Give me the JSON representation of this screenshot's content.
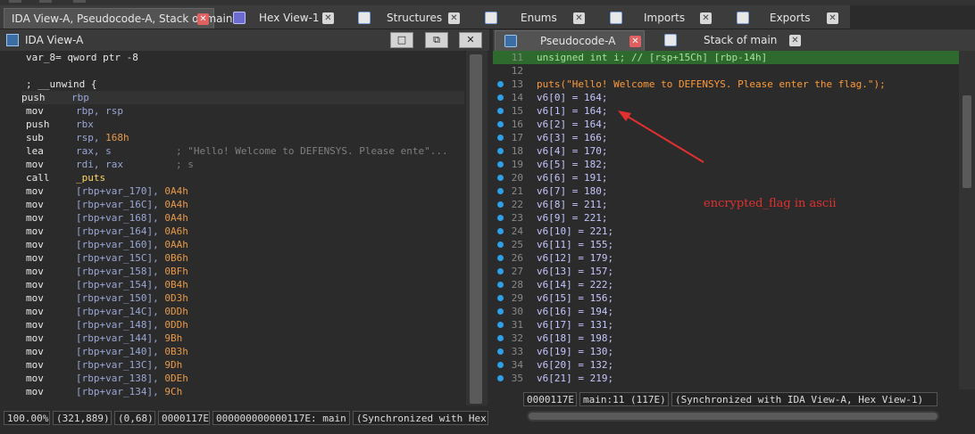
{
  "colors": {
    "accent_red": "#e23030",
    "sync_green": "#2e6a2e",
    "dot_blue": "#2ea0e8"
  },
  "tabs": [
    {
      "label": "IDA View-A, Pseudocode-A, Stack of main",
      "icon": "window-icon"
    },
    {
      "label": "Hex View-1",
      "icon": "hex-view-icon"
    },
    {
      "label": "Structures",
      "icon": "structures-icon"
    },
    {
      "label": "Enums",
      "icon": "enums-icon"
    },
    {
      "label": "Imports",
      "icon": "imports-icon"
    },
    {
      "label": "Exports",
      "icon": "exports-icon"
    }
  ],
  "left_panel": {
    "title": "IDA View-A",
    "buttons": {
      "restore": "□",
      "float": "⧉",
      "close": "✕"
    },
    "lines": [
      {
        "mn": "var_8= qword ptr -8",
        "op": "",
        "cm": ""
      },
      {
        "mn": "",
        "op": "",
        "cm": ""
      },
      {
        "mn": "; __unwind {",
        "op": "",
        "cm": ""
      },
      {
        "mn": "push",
        "op": "rbp",
        "cm": ""
      },
      {
        "mn": "mov",
        "op": "rbp, rsp",
        "cm": ""
      },
      {
        "mn": "push",
        "op": "rbx",
        "cm": ""
      },
      {
        "mn": "sub",
        "op": "rsp, ",
        "num": "168h",
        "cm": ""
      },
      {
        "mn": "lea",
        "op": "rax, s",
        "cm": "; \"Hello! Welcome to DEFENSYS. Please ente\"..."
      },
      {
        "mn": "mov",
        "op": "rdi, rax",
        "cm": "; s"
      },
      {
        "mn": "call",
        "op": "_puts",
        "cm": ""
      },
      {
        "mn": "mov",
        "op": "[rbp+var_170], ",
        "num": "0A4h",
        "cm": ""
      },
      {
        "mn": "mov",
        "op": "[rbp+var_16C], ",
        "num": "0A4h",
        "cm": ""
      },
      {
        "mn": "mov",
        "op": "[rbp+var_168], ",
        "num": "0A4h",
        "cm": ""
      },
      {
        "mn": "mov",
        "op": "[rbp+var_164], ",
        "num": "0A6h",
        "cm": ""
      },
      {
        "mn": "mov",
        "op": "[rbp+var_160], ",
        "num": "0AAh",
        "cm": ""
      },
      {
        "mn": "mov",
        "op": "[rbp+var_15C], ",
        "num": "0B6h",
        "cm": ""
      },
      {
        "mn": "mov",
        "op": "[rbp+var_158], ",
        "num": "0BFh",
        "cm": ""
      },
      {
        "mn": "mov",
        "op": "[rbp+var_154], ",
        "num": "0B4h",
        "cm": ""
      },
      {
        "mn": "mov",
        "op": "[rbp+var_150], ",
        "num": "0D3h",
        "cm": ""
      },
      {
        "mn": "mov",
        "op": "[rbp+var_14C], ",
        "num": "0DDh",
        "cm": ""
      },
      {
        "mn": "mov",
        "op": "[rbp+var_148], ",
        "num": "0DDh",
        "cm": ""
      },
      {
        "mn": "mov",
        "op": "[rbp+var_144], ",
        "num": "9Bh",
        "cm": ""
      },
      {
        "mn": "mov",
        "op": "[rbp+var_140], ",
        "num": "0B3h",
        "cm": ""
      },
      {
        "mn": "mov",
        "op": "[rbp+var_13C], ",
        "num": "9Dh",
        "cm": ""
      },
      {
        "mn": "mov",
        "op": "[rbp+var_138], ",
        "num": "0DEh",
        "cm": ""
      },
      {
        "mn": "mov",
        "op": "[rbp+var_134], ",
        "num": "9Ch",
        "cm": ""
      }
    ],
    "status": [
      "100.00%",
      "(321,889)",
      "(0,68)",
      "0000117E",
      "000000000000117E: main",
      "(Synchronized with Hex"
    ]
  },
  "right_panel": {
    "tabs": [
      {
        "label": "Pseudocode-A"
      },
      {
        "label": "Stack of main"
      }
    ],
    "lines": [
      {
        "n": "11",
        "dot": false,
        "sync": true,
        "text": "unsigned int i; // [rsp+15Ch] [rbp-14h]"
      },
      {
        "n": "12",
        "dot": false,
        "sync": false,
        "text": ""
      },
      {
        "n": "13",
        "dot": true,
        "sync": false,
        "text": "puts(\"Hello! Welcome to DEFENSYS. Please enter the flag.\");"
      },
      {
        "n": "14",
        "dot": true,
        "text": "v6[0] = 164;"
      },
      {
        "n": "15",
        "dot": true,
        "text": "v6[1] = 164;"
      },
      {
        "n": "16",
        "dot": true,
        "text": "v6[2] = 164;"
      },
      {
        "n": "17",
        "dot": true,
        "text": "v6[3] = 166;"
      },
      {
        "n": "18",
        "dot": true,
        "text": "v6[4] = 170;"
      },
      {
        "n": "19",
        "dot": true,
        "text": "v6[5] = 182;"
      },
      {
        "n": "20",
        "dot": true,
        "text": "v6[6] = 191;"
      },
      {
        "n": "21",
        "dot": true,
        "text": "v6[7] = 180;"
      },
      {
        "n": "22",
        "dot": true,
        "text": "v6[8] = 211;"
      },
      {
        "n": "23",
        "dot": true,
        "text": "v6[9] = 221;"
      },
      {
        "n": "24",
        "dot": true,
        "text": "v6[10] = 221;"
      },
      {
        "n": "25",
        "dot": true,
        "text": "v6[11] = 155;"
      },
      {
        "n": "26",
        "dot": true,
        "text": "v6[12] = 179;"
      },
      {
        "n": "27",
        "dot": true,
        "text": "v6[13] = 157;"
      },
      {
        "n": "28",
        "dot": true,
        "text": "v6[14] = 222;"
      },
      {
        "n": "29",
        "dot": true,
        "text": "v6[15] = 156;"
      },
      {
        "n": "30",
        "dot": true,
        "text": "v6[16] = 194;"
      },
      {
        "n": "31",
        "dot": true,
        "text": "v6[17] = 131;"
      },
      {
        "n": "32",
        "dot": true,
        "text": "v6[18] = 198;"
      },
      {
        "n": "33",
        "dot": true,
        "text": "v6[19] = 130;"
      },
      {
        "n": "34",
        "dot": true,
        "text": "v6[20] = 132;"
      },
      {
        "n": "35",
        "dot": true,
        "text": "v6[21] = 219;"
      }
    ],
    "annotation": "encrypted_flag in ascii",
    "status": [
      "0000117E",
      "main:11 (117E)",
      "(Synchronized with IDA View-A, Hex View-1)"
    ]
  }
}
